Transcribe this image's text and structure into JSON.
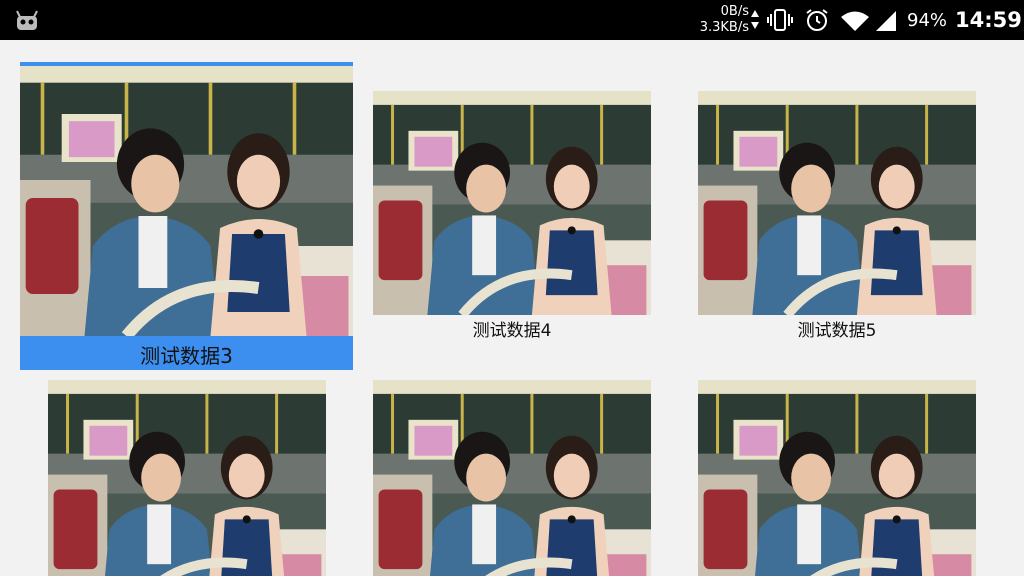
{
  "status_bar": {
    "net_up": "0B/s",
    "net_down": "3.3KB/s",
    "battery": "94%",
    "time": "14:59",
    "icons": [
      "android-debug-icon",
      "network-speed-arrows-icon",
      "vibrate-icon",
      "alarm-icon",
      "wifi-icon",
      "signal-icon"
    ]
  },
  "grid": {
    "items": [
      {
        "caption": "测试数据3",
        "focused": true
      },
      {
        "caption": "测试数据4",
        "focused": false
      },
      {
        "caption": "测试数据5",
        "focused": false
      },
      {
        "caption": "",
        "focused": false
      },
      {
        "caption": "",
        "focused": false
      },
      {
        "caption": "",
        "focused": false
      }
    ]
  },
  "colors": {
    "focus": "#3d8fef",
    "background": "#f2f2f2",
    "status_bar": "#000000"
  }
}
